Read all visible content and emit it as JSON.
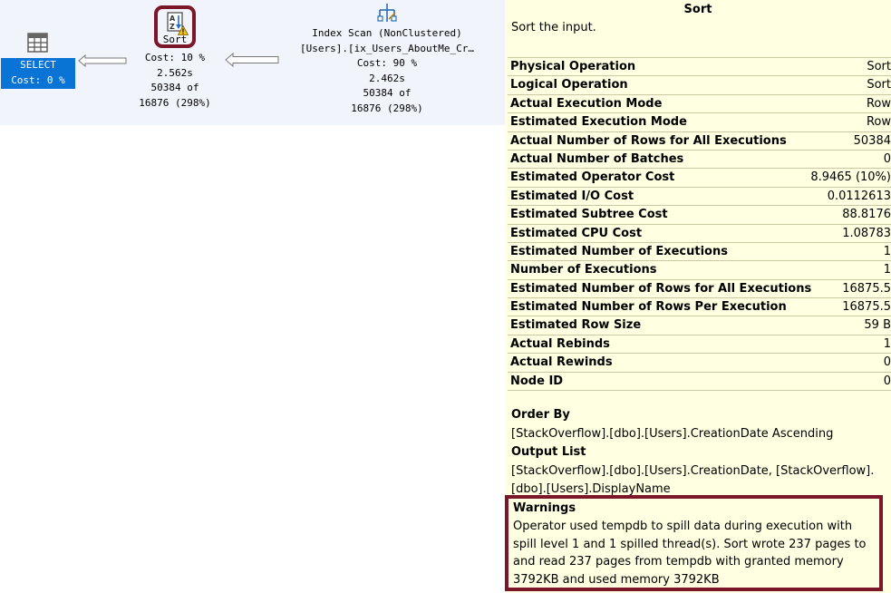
{
  "plan": {
    "select": {
      "label": "SELECT",
      "cost": "Cost: 0 %"
    },
    "sort": {
      "label": "Sort",
      "cost": "Cost: 10 %",
      "time": "2.562s",
      "rows": "50384 of",
      "est_rows": "16876 (298%)"
    },
    "scan": {
      "title": "Index Scan (NonClustered)",
      "object": "[Users].[ix_Users_AboutMe_Cr…",
      "cost": "Cost: 90 %",
      "time": "2.462s",
      "rows": "50384 of",
      "est_rows": "16876 (298%)"
    }
  },
  "tooltip": {
    "title": "Sort",
    "description": "Sort the input.",
    "properties": [
      {
        "name": "Physical Operation",
        "value": "Sort"
      },
      {
        "name": "Logical Operation",
        "value": "Sort"
      },
      {
        "name": "Actual Execution Mode",
        "value": "Row"
      },
      {
        "name": "Estimated Execution Mode",
        "value": "Row"
      },
      {
        "name": "Actual Number of Rows for All Executions",
        "value": "50384"
      },
      {
        "name": "Actual Number of Batches",
        "value": "0"
      },
      {
        "name": "Estimated Operator Cost",
        "value": "8.9465 (10%)"
      },
      {
        "name": "Estimated I/O Cost",
        "value": "0.0112613"
      },
      {
        "name": "Estimated Subtree Cost",
        "value": "88.8176"
      },
      {
        "name": "Estimated CPU Cost",
        "value": "1.08783"
      },
      {
        "name": "Estimated Number of Executions",
        "value": "1"
      },
      {
        "name": "Number of Executions",
        "value": "1"
      },
      {
        "name": "Estimated Number of Rows for All Executions",
        "value": "16875.5"
      },
      {
        "name": "Estimated Number of Rows Per Execution",
        "value": "16875.5"
      },
      {
        "name": "Estimated Row Size",
        "value": "59 B"
      },
      {
        "name": "Actual Rebinds",
        "value": "1"
      },
      {
        "name": "Actual Rewinds",
        "value": "0"
      },
      {
        "name": "Node ID",
        "value": "0"
      }
    ],
    "order_by_header": "Order By",
    "order_by": "[StackOverflow].[dbo].[Users].CreationDate Ascending",
    "output_list_header": "Output List",
    "output_list": "[StackOverflow].[dbo].[Users].CreationDate, [StackOverflow].[dbo].[Users].DisplayName",
    "warnings_header": "Warnings",
    "warnings": "Operator used tempdb to spill data during execution with spill level 1 and 1 spilled thread(s). Sort wrote 237 pages to and read 237 pages from tempdb with granted memory 3792KB and used memory 3792KB"
  },
  "colors": {
    "plan_bg": "#f1f4fa",
    "tooltip_bg": "#ffffe1",
    "select_highlight": "#0a74d6",
    "callout_border": "#7b1728"
  }
}
